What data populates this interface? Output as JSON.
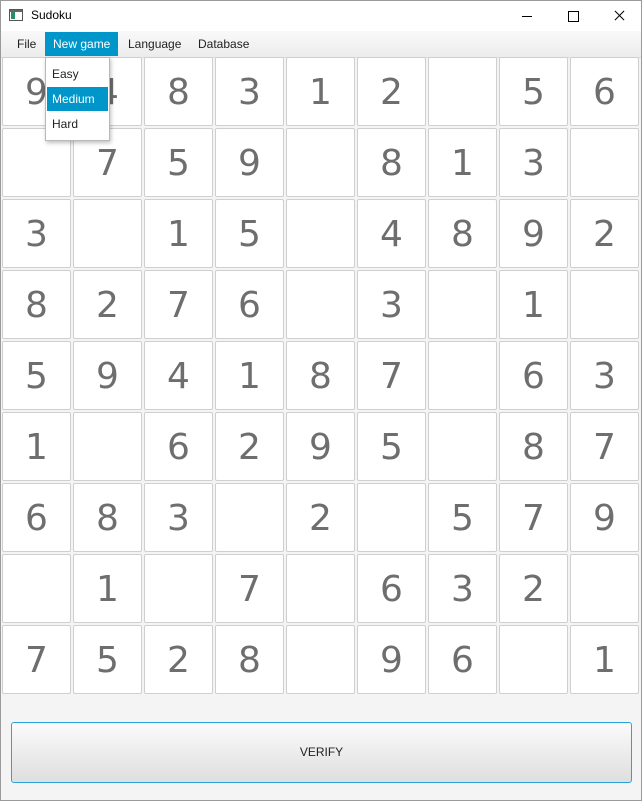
{
  "window": {
    "title": "Sudoku",
    "icon": "sudoku-app-icon"
  },
  "menubar": {
    "items": [
      {
        "label": "File"
      },
      {
        "label": "New game",
        "active": true
      },
      {
        "label": "Language"
      },
      {
        "label": "Database"
      }
    ]
  },
  "dropdown": {
    "items": [
      {
        "label": "Easy"
      },
      {
        "label": "Medium",
        "selected": true
      },
      {
        "label": "Hard"
      }
    ]
  },
  "board": [
    [
      "9",
      "4",
      "8",
      "3",
      "1",
      "2",
      "",
      "5",
      "6"
    ],
    [
      "",
      "7",
      "5",
      "9",
      "",
      "8",
      "1",
      "3",
      ""
    ],
    [
      "3",
      "",
      "1",
      "5",
      "",
      "4",
      "8",
      "9",
      "2"
    ],
    [
      "8",
      "2",
      "7",
      "6",
      "",
      "3",
      "",
      "1",
      ""
    ],
    [
      "5",
      "9",
      "4",
      "1",
      "8",
      "7",
      "",
      "6",
      "3"
    ],
    [
      "1",
      "",
      "6",
      "2",
      "9",
      "5",
      "",
      "8",
      "7"
    ],
    [
      "6",
      "8",
      "3",
      "",
      "2",
      "",
      "5",
      "7",
      "9"
    ],
    [
      "",
      "1",
      "",
      "7",
      "",
      "6",
      "3",
      "2",
      ""
    ],
    [
      "7",
      "5",
      "2",
      "8",
      "",
      "9",
      "6",
      "",
      "1"
    ]
  ],
  "verify": {
    "label": "VERIFY"
  },
  "colors": {
    "accent": "#0096c9",
    "digit": "#6e6e6e",
    "focus_border": "#2aa3d8"
  }
}
